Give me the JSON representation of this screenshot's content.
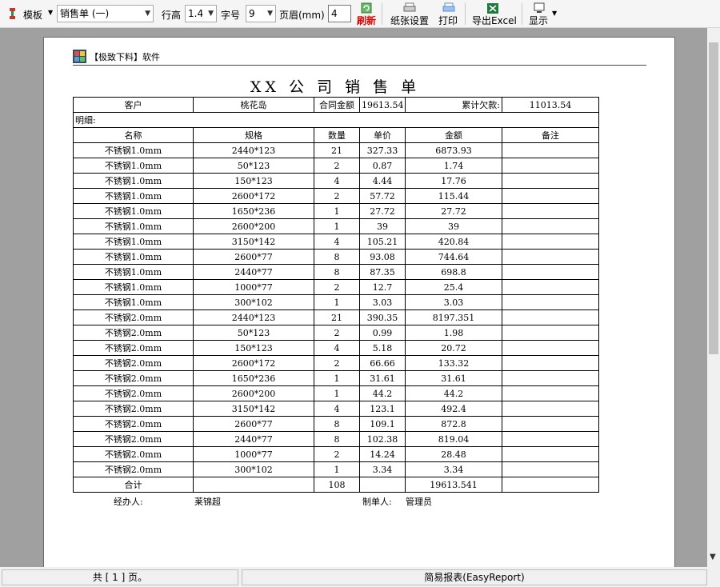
{
  "toolbar": {
    "template_label": "模板",
    "template_select": "销售单 (一)",
    "row_height_label": "行高",
    "row_height_value": "1.4",
    "font_size_label": "字号",
    "font_size_value": "9",
    "margin_label": "页眉(mm)",
    "margin_value": "4",
    "refresh_label": "刷新",
    "paper_label": "纸张设置",
    "print_label": "打印",
    "excel_label": "导出Excel",
    "display_label": "显示"
  },
  "report": {
    "header_tag": "【极致下料】软件",
    "title": "XX 公 司 销 售 单",
    "customer_label": "客户",
    "customer_value": "桃花岛",
    "contract_label": "合同金额",
    "contract_value": "19613.54",
    "debt_label": "累计欠款:",
    "debt_value": "11013.54",
    "detail_label": "明细:",
    "columns": [
      "名称",
      "规格",
      "数量",
      "单价",
      "金额",
      "备注"
    ],
    "rows": [
      [
        "不锈钢1.0mm",
        "2440*123",
        "21",
        "327.33",
        "6873.93",
        ""
      ],
      [
        "不锈钢1.0mm",
        "50*123",
        "2",
        "0.87",
        "1.74",
        ""
      ],
      [
        "不锈钢1.0mm",
        "150*123",
        "4",
        "4.44",
        "17.76",
        ""
      ],
      [
        "不锈钢1.0mm",
        "2600*172",
        "2",
        "57.72",
        "115.44",
        ""
      ],
      [
        "不锈钢1.0mm",
        "1650*236",
        "1",
        "27.72",
        "27.72",
        ""
      ],
      [
        "不锈钢1.0mm",
        "2600*200",
        "1",
        "39",
        "39",
        ""
      ],
      [
        "不锈钢1.0mm",
        "3150*142",
        "4",
        "105.21",
        "420.84",
        ""
      ],
      [
        "不锈钢1.0mm",
        "2600*77",
        "8",
        "93.08",
        "744.64",
        ""
      ],
      [
        "不锈钢1.0mm",
        "2440*77",
        "8",
        "87.35",
        "698.8",
        ""
      ],
      [
        "不锈钢1.0mm",
        "1000*77",
        "2",
        "12.7",
        "25.4",
        ""
      ],
      [
        "不锈钢1.0mm",
        "300*102",
        "1",
        "3.03",
        "3.03",
        ""
      ],
      [
        "不锈钢2.0mm",
        "2440*123",
        "21",
        "390.35",
        "8197.351",
        ""
      ],
      [
        "不锈钢2.0mm",
        "50*123",
        "2",
        "0.99",
        "1.98",
        ""
      ],
      [
        "不锈钢2.0mm",
        "150*123",
        "4",
        "5.18",
        "20.72",
        ""
      ],
      [
        "不锈钢2.0mm",
        "2600*172",
        "2",
        "66.66",
        "133.32",
        ""
      ],
      [
        "不锈钢2.0mm",
        "1650*236",
        "1",
        "31.61",
        "31.61",
        ""
      ],
      [
        "不锈钢2.0mm",
        "2600*200",
        "1",
        "44.2",
        "44.2",
        ""
      ],
      [
        "不锈钢2.0mm",
        "3150*142",
        "4",
        "123.1",
        "492.4",
        ""
      ],
      [
        "不锈钢2.0mm",
        "2600*77",
        "8",
        "109.1",
        "872.8",
        ""
      ],
      [
        "不锈钢2.0mm",
        "2440*77",
        "8",
        "102.38",
        "819.04",
        ""
      ],
      [
        "不锈钢2.0mm",
        "1000*77",
        "2",
        "14.24",
        "28.48",
        ""
      ],
      [
        "不锈钢2.0mm",
        "300*102",
        "1",
        "3.34",
        "3.34",
        ""
      ]
    ],
    "total_label": "合计",
    "total_qty": "108",
    "total_amount": "19613.541",
    "handler_label": "经办人:",
    "handler_value": "莱锦超",
    "maker_label": "制单人:",
    "maker_value": "管理员"
  },
  "status": {
    "pages": "共 [ 1 ] 页。",
    "product": "简易报表(EasyReport)"
  },
  "colors": {
    "refresh_red": "#e00000",
    "excel_green": "#1d7a3a",
    "print_blue": "#5b8fd6"
  }
}
